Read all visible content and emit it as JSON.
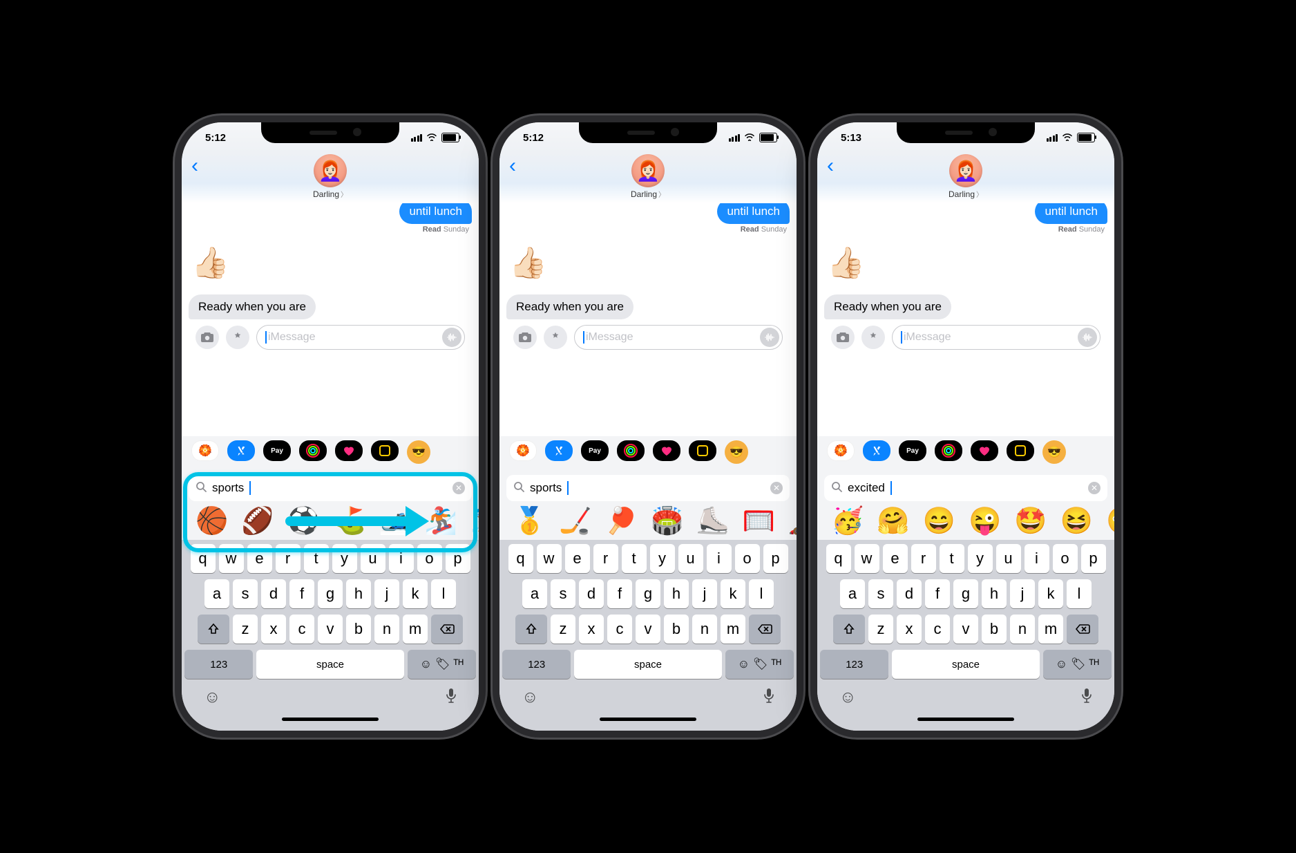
{
  "phones": [
    {
      "time": "5:12",
      "contact": "Darling",
      "sent_msg": "until lunch",
      "receipt_status": "Read",
      "receipt_day": "Sunday",
      "thumbs": "👍🏻",
      "reply": "Ready when you are",
      "placeholder": "iMessage",
      "search": "sports",
      "emojis": [
        "🏀",
        "🏈",
        "⚽",
        "⛳",
        "🎿",
        "🏂",
        "⛷️"
      ],
      "highlight": true
    },
    {
      "time": "5:12",
      "contact": "Darling",
      "sent_msg": "until lunch",
      "receipt_status": "Read",
      "receipt_day": "Sunday",
      "thumbs": "👍🏻",
      "reply": "Ready when you are",
      "placeholder": "iMessage",
      "search": "sports",
      "emojis": [
        "🥇",
        "🏒",
        "🏓",
        "🏟️",
        "⛸️",
        "🥅",
        "🏎️"
      ],
      "highlight": false
    },
    {
      "time": "5:13",
      "contact": "Darling",
      "sent_msg": "until lunch",
      "receipt_status": "Read",
      "receipt_day": "Sunday",
      "thumbs": "👍🏻",
      "reply": "Ready when you are",
      "placeholder": "iMessage",
      "search": "excited",
      "emojis": [
        "🥳",
        "🤗",
        "😄",
        "😜",
        "🤩",
        "😆",
        "🤪"
      ],
      "highlight": false
    }
  ],
  "apps": {
    "pay": "Pay"
  },
  "kb": {
    "r1": [
      "q",
      "w",
      "e",
      "r",
      "t",
      "y",
      "u",
      "i",
      "o",
      "p"
    ],
    "r2": [
      "a",
      "s",
      "d",
      "f",
      "g",
      "h",
      "j",
      "k",
      "l"
    ],
    "r3": [
      "z",
      "x",
      "c",
      "v",
      "b",
      "n",
      "m"
    ],
    "num": "123",
    "space": "space"
  }
}
